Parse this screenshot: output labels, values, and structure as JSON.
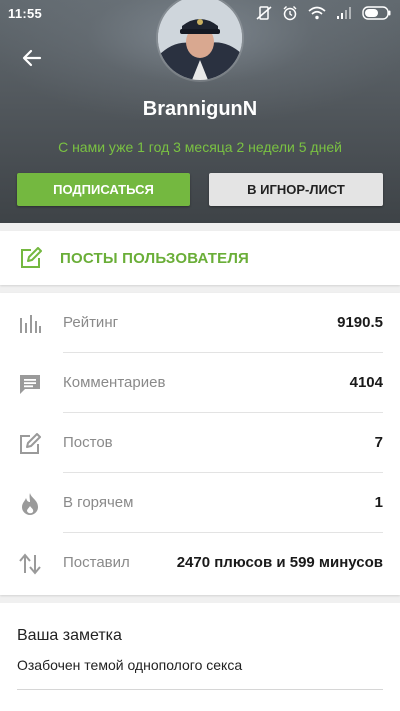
{
  "status_bar": {
    "time": "11:55"
  },
  "profile": {
    "username": "BrannigunN",
    "member_since": "С нами уже 1 год 3 месяца 2 недели 5 дней"
  },
  "actions": {
    "subscribe_label": "ПОДПИСАТЬСЯ",
    "ignore_label": "В ИГНОР-ЛИСТ"
  },
  "posts_link": {
    "label": "ПОСТЫ ПОЛЬЗОВАТЕЛЯ"
  },
  "stats": [
    {
      "icon": "bar-chart-icon",
      "label": "Рейтинг",
      "value": "9190.5"
    },
    {
      "icon": "comment-icon",
      "label": "Комментариев",
      "value": "4104"
    },
    {
      "icon": "edit-icon",
      "label": "Постов",
      "value": "7"
    },
    {
      "icon": "fire-icon",
      "label": "В горячем",
      "value": "1"
    },
    {
      "icon": "sort-arrows-icon",
      "label": "Поставил",
      "value": "2470 плюсов и 599 минусов"
    }
  ],
  "note": {
    "title": "Ваша заметка",
    "text": "Озабочен темой однополого секса"
  },
  "colors": {
    "accent_green": "#74b840",
    "header_bg": "#52585d",
    "icon_gray": "#9a9a9a"
  }
}
